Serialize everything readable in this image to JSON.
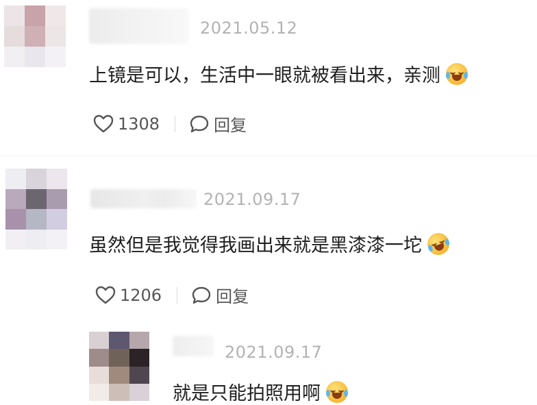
{
  "colors": {
    "background": "#ffffff",
    "text": "#1f1f1f",
    "meta": "#b2b2b2",
    "action": "#555555"
  },
  "comments": [
    {
      "date": "2021.05.12",
      "text": "上镜是可以，生活中一眼就被看出来，亲测",
      "emoji": "crying-laughing-emoji",
      "likes": "1308",
      "reply_label": "回复"
    },
    {
      "date": "2021.09.17",
      "text": "虽然但是我觉得我画出来就是黑漆漆一坨",
      "emoji": "rolling-laughing-emoji",
      "likes": "1206",
      "reply_label": "回复"
    }
  ],
  "reply": {
    "date": "2021.09.17",
    "text": "就是只能拍照用啊",
    "emoji": "crying-laughing-emoji"
  },
  "icons": {
    "like": "heart-outline-icon",
    "reply": "speech-bubble-icon"
  }
}
